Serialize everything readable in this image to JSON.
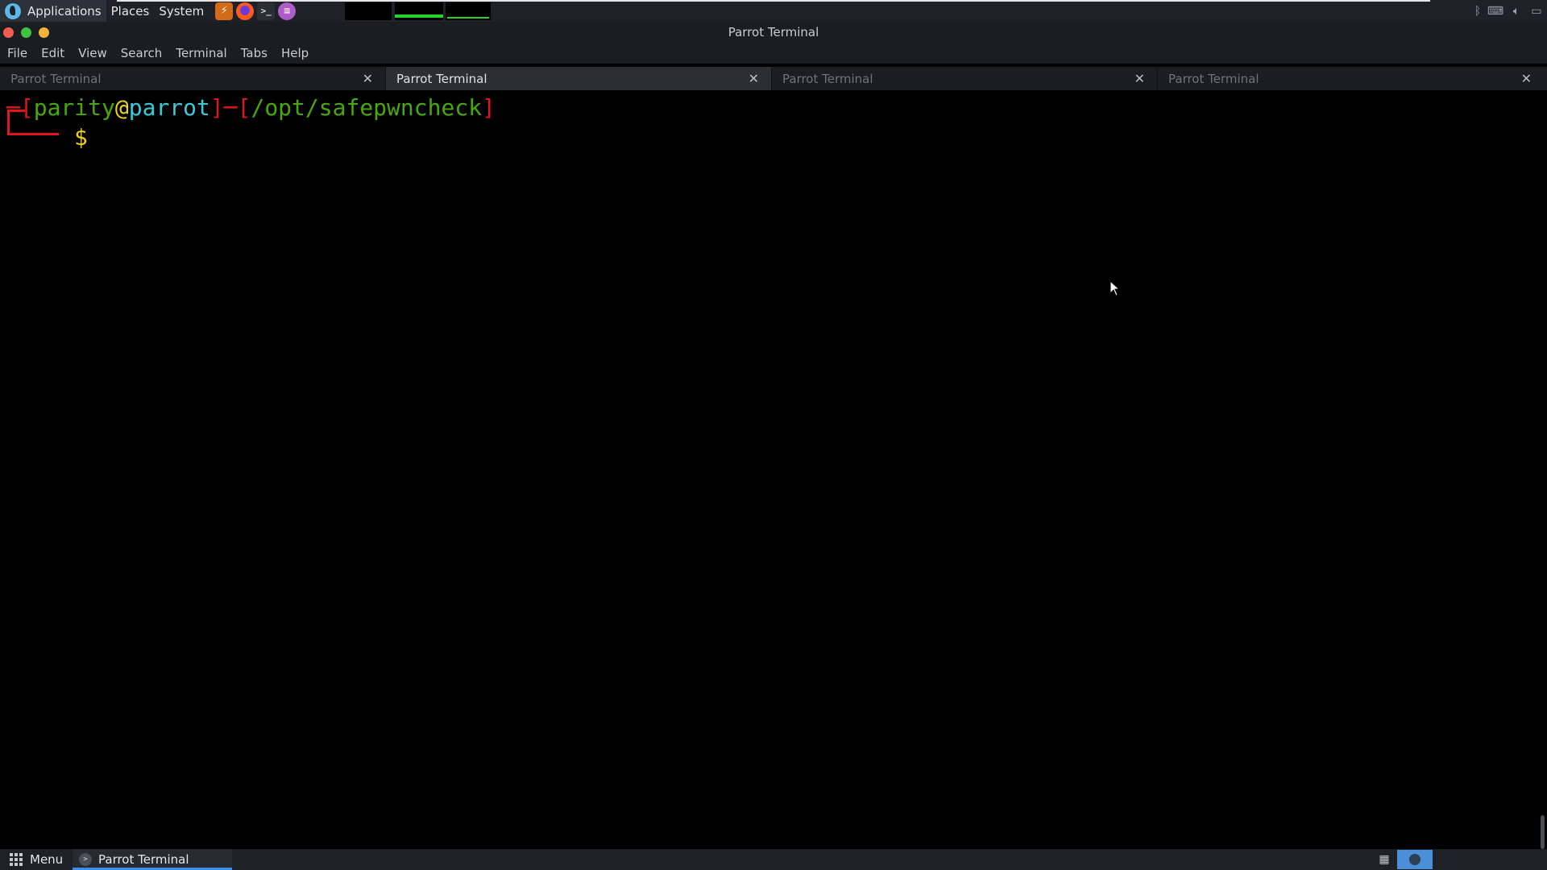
{
  "top_panel": {
    "applications_label": "Applications",
    "places_label": "Places",
    "system_label": "System"
  },
  "window": {
    "title": "Parrot Terminal"
  },
  "menu_bar": {
    "items": [
      "File",
      "Edit",
      "View",
      "Search",
      "Terminal",
      "Tabs",
      "Help"
    ]
  },
  "tabs": [
    {
      "label": "Parrot Terminal",
      "active": false
    },
    {
      "label": "Parrot Terminal",
      "active": true
    },
    {
      "label": "Parrot Terminal",
      "active": false
    },
    {
      "label": "Parrot Terminal",
      "active": false
    }
  ],
  "terminal": {
    "user": "parity",
    "at": "@",
    "host": "parrot",
    "cwd": "/opt/safepwncheck",
    "prompt_symbol": "$"
  },
  "bottom_panel": {
    "menu_label": "Menu",
    "task_label": "Parrot Terminal"
  },
  "colors": {
    "prompt_bracket": "#e0151d",
    "prompt_user": "#49a80c",
    "prompt_at": "#f0d21a",
    "prompt_host": "#3ec9d6",
    "prompt_symbol": "#f0d21a",
    "active_task_underline": "#3b8ee8"
  }
}
